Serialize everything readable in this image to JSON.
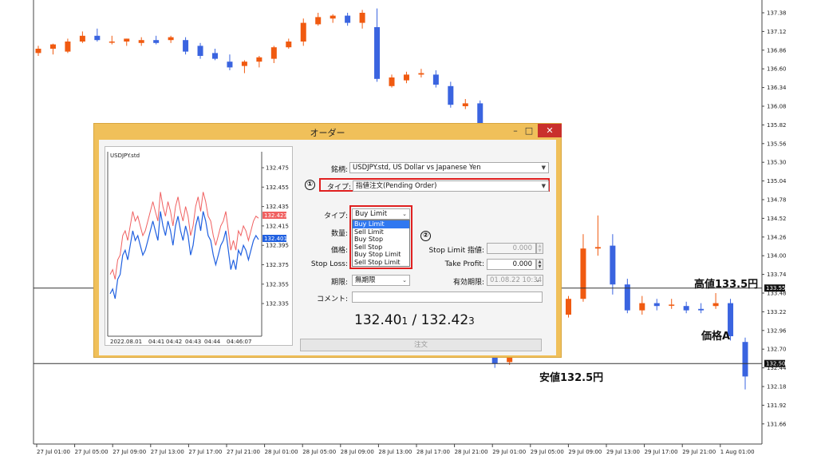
{
  "price_axis": {
    "labels": [
      "137.38",
      "137.12",
      "136.86",
      "136.60",
      "136.34",
      "136.08",
      "135.82",
      "135.56",
      "135.30",
      "135.04",
      "134.78",
      "134.52",
      "134.26",
      "134.00",
      "133.74",
      "133.48",
      "133.22",
      "132.96",
      "132.70",
      "132.44",
      "132.18",
      "131.92",
      "131.66"
    ],
    "line_labels": {
      "high": "133.55",
      "low": "132.50"
    }
  },
  "time_axis": {
    "labels": [
      "27 Jul 01:00",
      "27 Jul 05:00",
      "27 Jul 09:00",
      "27 Jul 13:00",
      "27 Jul 17:00",
      "27 Jul 21:00",
      "28 Jul 01:00",
      "28 Jul 05:00",
      "28 Jul 09:00",
      "28 Jul 13:00",
      "28 Jul 17:00",
      "28 Jul 21:00",
      "29 Jul 01:00",
      "29 Jul 05:00",
      "29 Jul 09:00",
      "29 Jul 13:00",
      "29 Jul 17:00",
      "29 Jul 21:00",
      "1 Aug 01:00"
    ]
  },
  "price_lines": {
    "high_value": 133.55,
    "low_value": 132.5
  },
  "annotations": {
    "high": "高値133.5円",
    "low": "安値132.5円",
    "price_a": "価格A"
  },
  "colors": {
    "bull": "#f05a10",
    "bear": "#3a64e0",
    "highlight": "#e02020",
    "selected": "#3078f0",
    "close": "#c9302c"
  },
  "candles": [
    {
      "o": 136.82,
      "h": 136.92,
      "l": 136.78,
      "c": 136.88
    },
    {
      "o": 136.88,
      "h": 136.95,
      "l": 136.8,
      "c": 136.94
    },
    {
      "o": 136.84,
      "h": 137.02,
      "l": 136.82,
      "c": 136.98
    },
    {
      "o": 136.98,
      "h": 137.12,
      "l": 136.96,
      "c": 137.06
    },
    {
      "o": 137.06,
      "h": 137.16,
      "l": 136.98,
      "c": 137.0
    },
    {
      "o": 136.98,
      "h": 137.06,
      "l": 136.94,
      "c": 136.98
    },
    {
      "o": 136.98,
      "h": 137.02,
      "l": 136.92,
      "c": 137.02
    },
    {
      "o": 136.96,
      "h": 137.04,
      "l": 136.92,
      "c": 137.0
    },
    {
      "o": 137.0,
      "h": 137.06,
      "l": 136.94,
      "c": 136.96
    },
    {
      "o": 137.0,
      "h": 137.06,
      "l": 136.96,
      "c": 137.04
    },
    {
      "o": 137.0,
      "h": 137.04,
      "l": 136.8,
      "c": 136.84
    },
    {
      "o": 136.92,
      "h": 136.96,
      "l": 136.74,
      "c": 136.78
    },
    {
      "o": 136.82,
      "h": 136.88,
      "l": 136.72,
      "c": 136.74
    },
    {
      "o": 136.7,
      "h": 136.8,
      "l": 136.58,
      "c": 136.62
    },
    {
      "o": 136.64,
      "h": 136.72,
      "l": 136.54,
      "c": 136.7
    },
    {
      "o": 136.7,
      "h": 136.78,
      "l": 136.62,
      "c": 136.76
    },
    {
      "o": 136.74,
      "h": 136.92,
      "l": 136.68,
      "c": 136.9
    },
    {
      "o": 136.9,
      "h": 137.02,
      "l": 136.88,
      "c": 136.98
    },
    {
      "o": 136.98,
      "h": 137.3,
      "l": 136.92,
      "c": 137.24
    },
    {
      "o": 137.22,
      "h": 137.38,
      "l": 137.2,
      "c": 137.32
    },
    {
      "o": 137.3,
      "h": 137.36,
      "l": 137.24,
      "c": 137.34
    },
    {
      "o": 137.34,
      "h": 137.38,
      "l": 137.2,
      "c": 137.24
    },
    {
      "o": 137.24,
      "h": 137.42,
      "l": 137.16,
      "c": 137.38
    },
    {
      "o": 137.18,
      "h": 137.44,
      "l": 136.42,
      "c": 136.46
    },
    {
      "o": 136.36,
      "h": 136.52,
      "l": 136.34,
      "c": 136.48
    },
    {
      "o": 136.44,
      "h": 136.56,
      "l": 136.4,
      "c": 136.52
    },
    {
      "o": 136.52,
      "h": 136.6,
      "l": 136.48,
      "c": 136.54
    },
    {
      "o": 136.52,
      "h": 136.58,
      "l": 136.34,
      "c": 136.38
    },
    {
      "o": 136.36,
      "h": 136.42,
      "l": 136.06,
      "c": 136.1
    },
    {
      "o": 136.08,
      "h": 136.18,
      "l": 136.04,
      "c": 136.12
    },
    {
      "o": 136.12,
      "h": 136.16,
      "l": 135.7,
      "c": 135.76
    },
    {
      "o": 132.92,
      "h": 133.06,
      "l": 132.44,
      "c": 132.5
    },
    {
      "o": 132.52,
      "h": 132.8,
      "l": 132.48,
      "c": 132.76
    },
    {
      "o": 132.74,
      "h": 133.0,
      "l": 132.7,
      "c": 132.96
    },
    {
      "o": 132.96,
      "h": 133.4,
      "l": 132.92,
      "c": 133.36
    },
    {
      "o": 133.36,
      "h": 133.5,
      "l": 133.08,
      "c": 133.18
    },
    {
      "o": 133.18,
      "h": 133.44,
      "l": 133.14,
      "c": 133.4
    },
    {
      "o": 133.4,
      "h": 134.3,
      "l": 133.36,
      "c": 134.1
    },
    {
      "o": 134.1,
      "h": 134.56,
      "l": 134.0,
      "c": 134.12
    },
    {
      "o": 134.14,
      "h": 134.3,
      "l": 133.46,
      "c": 133.6
    },
    {
      "o": 133.6,
      "h": 133.68,
      "l": 133.2,
      "c": 133.24
    },
    {
      "o": 133.24,
      "h": 133.44,
      "l": 133.18,
      "c": 133.34
    },
    {
      "o": 133.34,
      "h": 133.4,
      "l": 133.24,
      "c": 133.3
    },
    {
      "o": 133.32,
      "h": 133.4,
      "l": 133.26,
      "c": 133.32
    },
    {
      "o": 133.3,
      "h": 133.36,
      "l": 133.2,
      "c": 133.24
    },
    {
      "o": 133.26,
      "h": 133.34,
      "l": 133.2,
      "c": 133.24
    },
    {
      "o": 133.3,
      "h": 133.48,
      "l": 133.26,
      "c": 133.34
    },
    {
      "o": 133.34,
      "h": 133.4,
      "l": 132.82,
      "c": 132.88
    },
    {
      "o": 132.8,
      "h": 132.86,
      "l": 132.14,
      "c": 132.32
    }
  ],
  "dialog": {
    "title": "オーダー",
    "buttons": {
      "minimize": "–",
      "maximize": "□",
      "close": "✕"
    },
    "mini_chart": {
      "symbol": "USDJPY.std",
      "price_labels": [
        "132.475",
        "132.455",
        "132.435",
        "132.415",
        "132.395",
        "132.375",
        "132.355",
        "132.335"
      ],
      "ask_tag": "132.423",
      "bid_tag": "132.401",
      "time_labels": [
        "2022.08.01",
        "04:41",
        "04:42",
        "04:43",
        "04:44",
        "04:46:07"
      ],
      "bid_series": [
        132.345,
        132.35,
        132.34,
        132.36,
        132.365,
        132.385,
        132.39,
        132.38,
        132.395,
        132.41,
        132.4,
        132.405,
        132.395,
        132.385,
        132.39,
        132.4,
        132.41,
        132.42,
        132.41,
        132.4,
        132.43,
        132.415,
        132.405,
        132.42,
        132.41,
        132.395,
        132.415,
        132.425,
        132.41,
        132.4,
        132.415,
        132.405,
        132.385,
        132.395,
        132.415,
        132.425,
        132.41,
        132.43,
        132.42,
        132.405,
        132.4,
        132.385,
        132.375,
        132.385,
        132.395,
        132.4,
        132.41,
        132.39,
        132.37,
        132.38,
        132.37,
        132.39,
        132.385,
        132.395,
        132.39,
        132.38,
        132.39,
        132.4,
        132.405,
        132.401
      ],
      "ask_series": [
        132.365,
        132.37,
        132.36,
        132.38,
        132.385,
        132.405,
        132.41,
        132.4,
        132.415,
        132.43,
        132.42,
        132.425,
        132.415,
        132.405,
        132.41,
        132.42,
        132.43,
        132.44,
        132.43,
        132.42,
        132.45,
        132.435,
        132.425,
        132.44,
        132.43,
        132.415,
        132.435,
        132.445,
        132.43,
        132.42,
        132.435,
        132.425,
        132.405,
        132.415,
        132.435,
        132.445,
        132.43,
        132.45,
        132.44,
        132.425,
        132.42,
        132.405,
        132.395,
        132.405,
        132.415,
        132.42,
        132.43,
        132.41,
        132.39,
        132.4,
        132.39,
        132.41,
        132.405,
        132.415,
        132.41,
        132.4,
        132.41,
        132.42,
        132.425,
        132.423
      ]
    },
    "form": {
      "symbol_label": "銘柄:",
      "symbol_value": "USDJPY.std, US Dollar vs Japanese Yen",
      "order_type_label": "タイプ:",
      "order_type_value": "指値注文(Pending Order)",
      "type_label": "タイプ:",
      "type_value": "Buy Limit",
      "type_options": [
        "Buy Limit",
        "Sell Limit",
        "Buy Stop",
        "Sell Stop",
        "Buy Stop Limit",
        "Sell Stop Limit"
      ],
      "volume_label": "数量:",
      "price_label": "価格:",
      "stop_loss_label": "Stop Loss:",
      "expiry_label": "期限:",
      "expiry_value": "無期限",
      "comment_label": "コメント:",
      "stop_limit_label": "Stop Limit 指値:",
      "stop_limit_value": "0.000",
      "take_profit_label": "Take Profit:",
      "take_profit_value": "0.000",
      "expiration_label": "有効期限:",
      "expiration_value": "01.08.22 10:34",
      "bid_ask_main": "132.40",
      "bid_ask_small": "1",
      "separator": " / ",
      "ask_main": "132.42",
      "ask_small": "3",
      "order_button": "注文"
    },
    "markers": {
      "one": "①",
      "two": "②"
    }
  }
}
